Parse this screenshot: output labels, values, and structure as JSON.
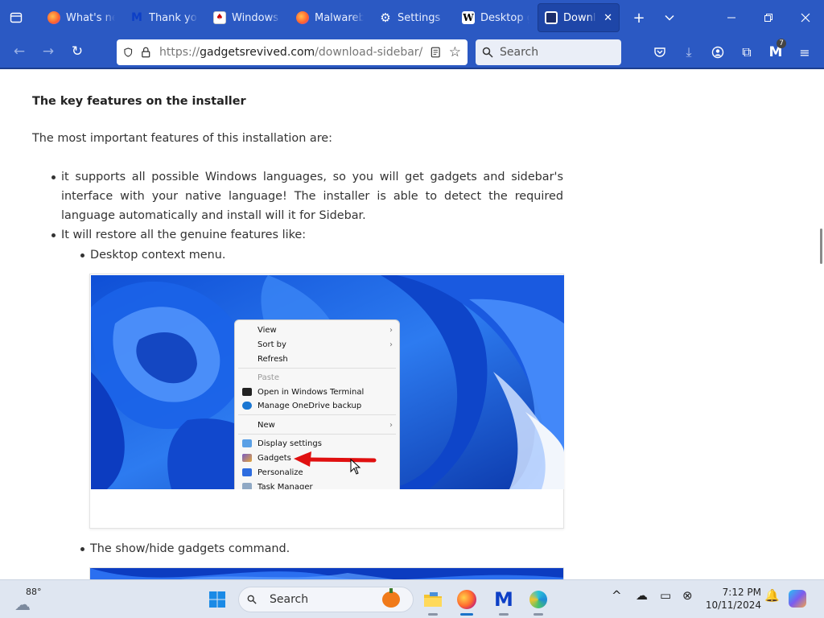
{
  "browser": {
    "tabs": [
      {
        "label": "What's new",
        "favicon": "firefox-icon",
        "active": false
      },
      {
        "label": "Thank you",
        "favicon": "malwarebytes-icon",
        "active": false
      },
      {
        "label": "Windows",
        "favicon": "cards-icon",
        "active": false
      },
      {
        "label": "Malwarebytes",
        "favicon": "firefox-icon",
        "active": false
      },
      {
        "label": "Settings",
        "favicon": "gear-icon",
        "active": false
      },
      {
        "label": "Desktop gadgets",
        "favicon": "wikipedia-icon",
        "active": false
      },
      {
        "label": "Download",
        "favicon": "site-icon",
        "active": true
      }
    ],
    "new_tab": "+",
    "url": {
      "scheme": "https://",
      "domain": "gadgetsrevived.com",
      "path": "/download-sidebar/"
    },
    "search_placeholder": "Search",
    "extensions_badge": "7"
  },
  "article": {
    "heading": "The key features on the installer",
    "intro": "The most important features of this installation are:",
    "bullets": [
      "it supports all possible Windows languages, so you will get gadgets and sidebar's interface with your native language! The installer is able to detect the required language automatically and install will it for Sidebar.",
      "It will restore all the genuine features like:"
    ],
    "sub_bullets": [
      "Desktop context menu.",
      "The show/hide gadgets command."
    ]
  },
  "context_menu": {
    "items": [
      {
        "label": "View",
        "submenu": true
      },
      {
        "label": "Sort by",
        "submenu": true
      },
      {
        "label": "Refresh"
      },
      {
        "label": "Paste",
        "disabled": true
      },
      {
        "label": "Open in Windows Terminal"
      },
      {
        "label": "Manage OneDrive backup"
      },
      {
        "label": "New",
        "submenu": true
      },
      {
        "label": "Display settings"
      },
      {
        "label": "Gadgets"
      },
      {
        "label": "Personalize"
      },
      {
        "label": "Task Manager"
      }
    ]
  },
  "taskbar": {
    "weather_temp": "88°",
    "search_label": "Search",
    "time": "7:12 PM",
    "date": "10/11/2024"
  },
  "colors": {
    "browser_chrome": "#2b59c3",
    "annotation_arrow": "#e01010",
    "wallpaper_blue": "#1f5fe0"
  }
}
